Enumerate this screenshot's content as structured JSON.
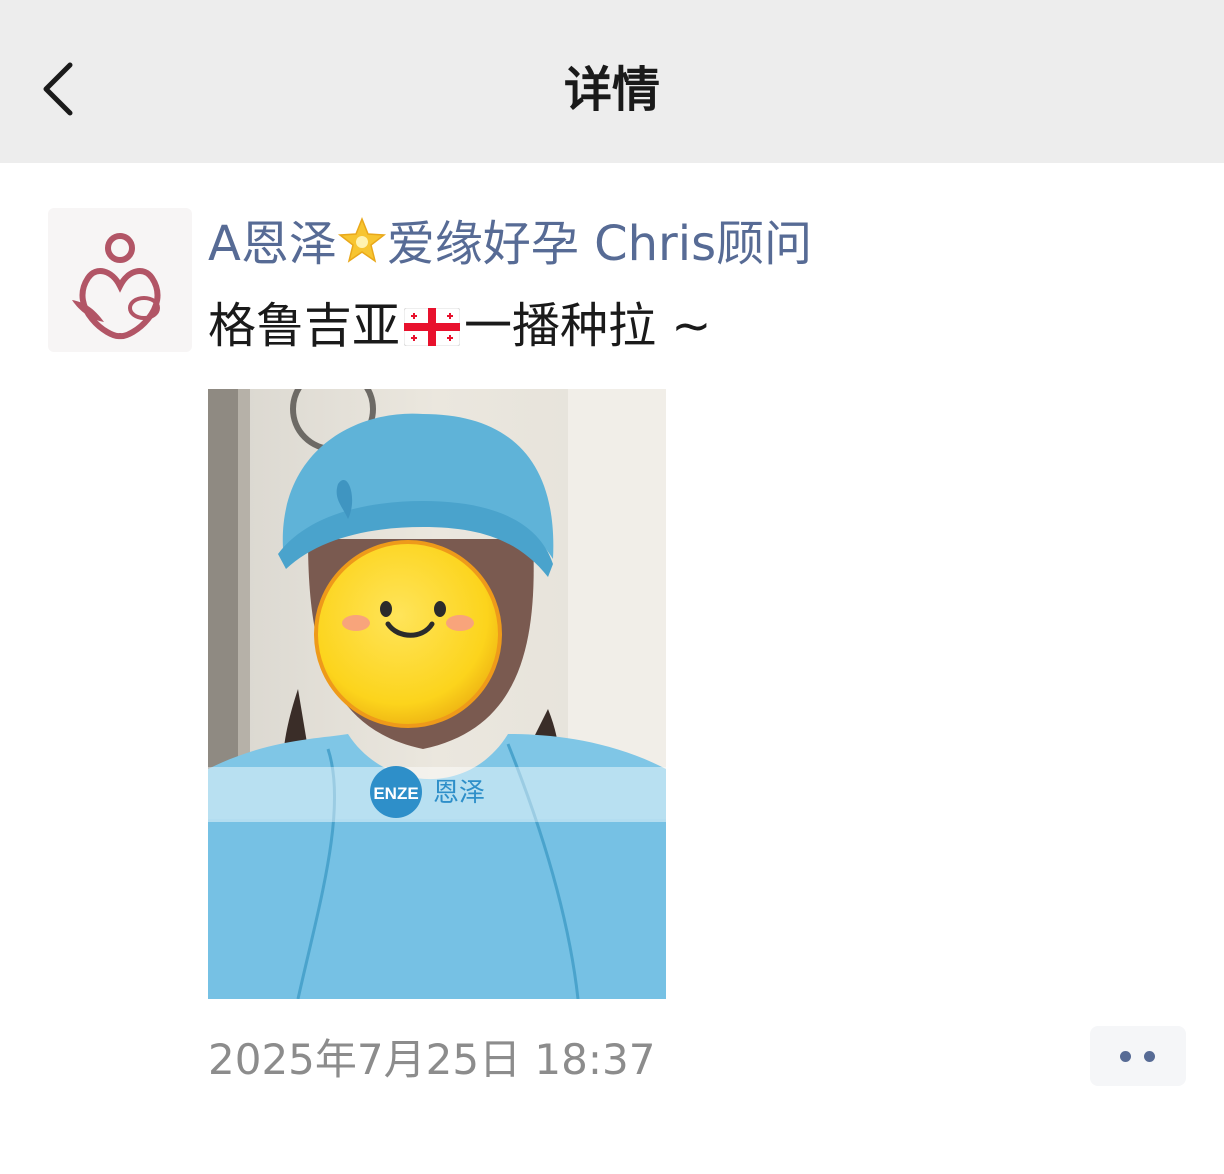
{
  "header": {
    "title": "详情",
    "back_icon": "chevron-left-icon"
  },
  "post": {
    "author_part1": "A恩泽",
    "author_emoji": "star-icon",
    "author_part2": "爱缘好孕 Chris顾问",
    "text_part1": "格鲁吉亚",
    "text_flag": "georgia-flag-icon",
    "text_part2": "一播种拉 ~",
    "photo_watermark_logo": "ENZE",
    "photo_watermark_text": "恩泽",
    "timestamp": "2025年7月25日 18:37",
    "more_icon": "more-dots-icon"
  },
  "colors": {
    "header_bg": "#ededed",
    "author_name": "#576b95",
    "timestamp": "#8c8c8c",
    "accent_dots": "#576b95"
  }
}
